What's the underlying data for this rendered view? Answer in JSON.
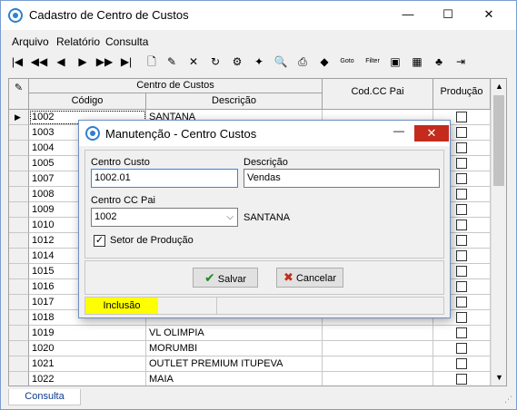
{
  "window": {
    "title": "Cadastro de Centro de Custos",
    "minimize": "—",
    "maximize": "☐",
    "close": "✕"
  },
  "menu": [
    {
      "label": "Arquivo"
    },
    {
      "label": "Relatório"
    },
    {
      "label": "Consulta"
    }
  ],
  "toolbar": [
    {
      "icon": "first-record-icon",
      "glyph": "|◀"
    },
    {
      "icon": "previous-page-icon",
      "glyph": "◀◀"
    },
    {
      "icon": "previous-record-icon",
      "glyph": "◀"
    },
    {
      "icon": "next-record-icon",
      "glyph": "▶"
    },
    {
      "icon": "next-page-icon",
      "glyph": "▶▶"
    },
    {
      "icon": "last-record-icon",
      "glyph": "▶|"
    },
    {
      "icon": "new-document-icon",
      "glyph": "🗋"
    },
    {
      "icon": "edit-document-icon",
      "glyph": "✎"
    },
    {
      "icon": "delete-icon",
      "glyph": "✕"
    },
    {
      "icon": "refresh-icon",
      "glyph": "↻"
    },
    {
      "icon": "properties-icon",
      "glyph": "⚙"
    },
    {
      "icon": "wand-icon",
      "glyph": "✦"
    },
    {
      "icon": "print-preview-icon",
      "glyph": "🔍"
    },
    {
      "icon": "print-icon",
      "glyph": "⎙"
    },
    {
      "icon": "tag-icon",
      "glyph": "◆"
    },
    {
      "icon": "goto-icon",
      "glyph": "Goto"
    },
    {
      "icon": "filter-icon",
      "glyph": "Filter"
    },
    {
      "icon": "export-icon",
      "glyph": "▣"
    },
    {
      "icon": "image-icon",
      "glyph": "▦"
    },
    {
      "icon": "tree-icon",
      "glyph": "♣"
    },
    {
      "icon": "exit-icon",
      "glyph": "⇥"
    }
  ],
  "grid": {
    "group_header": "Centro de Custos",
    "columns": {
      "codigo": "Código",
      "descricao": "Descrição",
      "cod_cc_pai": "Cod.CC Pai",
      "producao": "Produção"
    },
    "rows": [
      {
        "codigo": "1002",
        "descricao": "SANTANA",
        "cc_pai": "",
        "producao": false,
        "current": true
      },
      {
        "codigo": "1003",
        "descricao": "",
        "cc_pai": "",
        "producao": false
      },
      {
        "codigo": "1004",
        "descricao": "",
        "cc_pai": "",
        "producao": false
      },
      {
        "codigo": "1005",
        "descricao": "",
        "cc_pai": "",
        "producao": false
      },
      {
        "codigo": "1007",
        "descricao": "",
        "cc_pai": "",
        "producao": false
      },
      {
        "codigo": "1008",
        "descricao": "",
        "cc_pai": "",
        "producao": false
      },
      {
        "codigo": "1009",
        "descricao": "",
        "cc_pai": "",
        "producao": false
      },
      {
        "codigo": "1010",
        "descricao": "",
        "cc_pai": "",
        "producao": false
      },
      {
        "codigo": "1012",
        "descricao": "",
        "cc_pai": "",
        "producao": false
      },
      {
        "codigo": "1014",
        "descricao": "",
        "cc_pai": "",
        "producao": false
      },
      {
        "codigo": "1015",
        "descricao": "",
        "cc_pai": "",
        "producao": false
      },
      {
        "codigo": "1016",
        "descricao": "",
        "cc_pai": "",
        "producao": false
      },
      {
        "codigo": "1017",
        "descricao": "",
        "cc_pai": "",
        "producao": false
      },
      {
        "codigo": "1018",
        "descricao": "",
        "cc_pai": "",
        "producao": false
      },
      {
        "codigo": "1019",
        "descricao": "VL OLIMPIA",
        "cc_pai": "",
        "producao": false
      },
      {
        "codigo": "1020",
        "descricao": "MORUMBI",
        "cc_pai": "",
        "producao": false
      },
      {
        "codigo": "1021",
        "descricao": "OUTLET PREMIUM ITUPEVA",
        "cc_pai": "",
        "producao": false
      },
      {
        "codigo": "1022",
        "descricao": "MAIA",
        "cc_pai": "",
        "producao": false
      }
    ]
  },
  "status": {
    "tab": "Consulta"
  },
  "dialog": {
    "title": "Manutenção - Centro Custos",
    "minimize": "—",
    "close": "✕",
    "centro_custo_label": "Centro Custo",
    "centro_custo_value": "1002.01",
    "descricao_label": "Descrição",
    "descricao_value": "Vendas",
    "cc_pai_label": "Centro CC Pai",
    "cc_pai_value": "1002",
    "cc_pai_name": "SANTANA",
    "setor_label": "Setor de Produção",
    "setor_checked": "✓",
    "salvar_label": "Salvar",
    "cancelar_label": "Cancelar",
    "mode": "Inclusão"
  }
}
